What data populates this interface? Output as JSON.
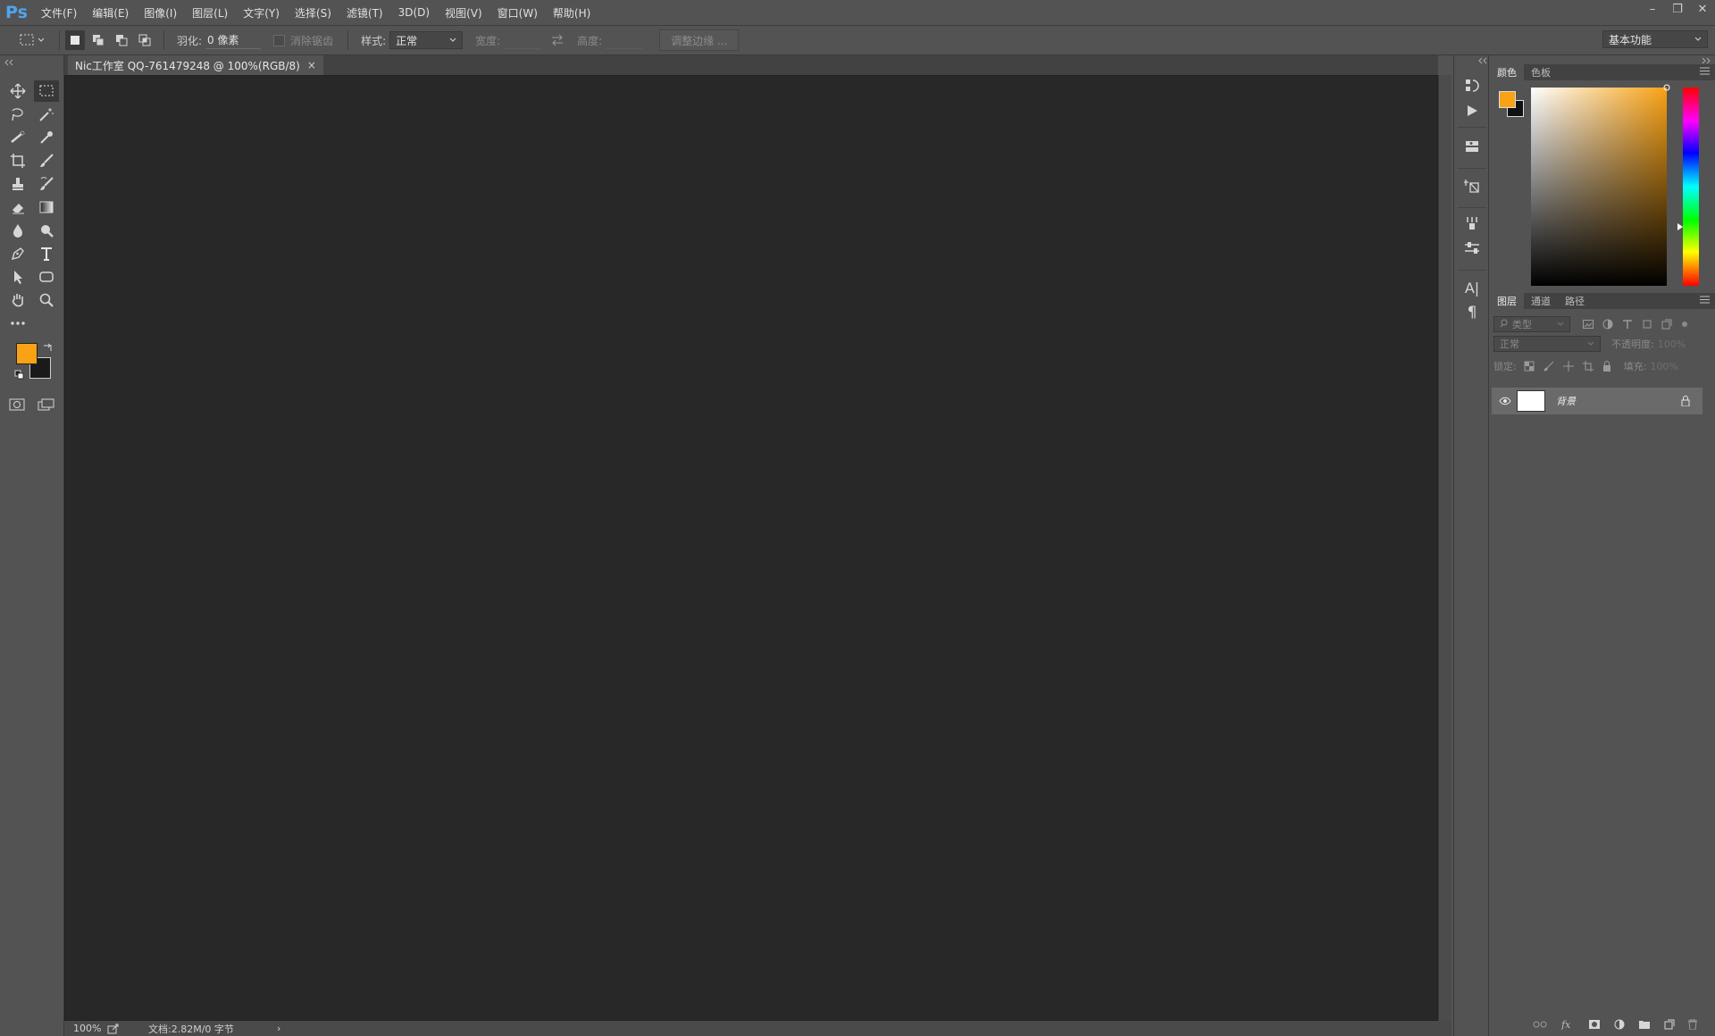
{
  "app": {
    "logo": "Ps"
  },
  "menu": [
    "文件(F)",
    "编辑(E)",
    "图像(I)",
    "图层(L)",
    "文字(Y)",
    "选择(S)",
    "滤镜(T)",
    "3D(D)",
    "视图(V)",
    "窗口(W)",
    "帮助(H)"
  ],
  "window": {
    "minimize": "–",
    "restore": "❐",
    "close": "✕"
  },
  "options": {
    "feather_label": "羽化:",
    "feather_value": "0 像素",
    "antialias_label": "消除锯齿",
    "style_label": "样式:",
    "style_value": "正常",
    "width_label": "宽度:",
    "height_label": "高度:",
    "refine_edge": "调整边缘 ...",
    "workspace": "基本功能"
  },
  "document": {
    "tab_title": "Nic工作室 QQ-761479248 @ 100%(RGB/8)",
    "close": "×"
  },
  "status": {
    "zoom": "100%",
    "doc_info": "文档:2.82M/0 字节",
    "arrow": "›"
  },
  "color_panel": {
    "tabs": [
      "颜色",
      "色板"
    ],
    "fg_color": "#f9a215",
    "bg_color": "#111111"
  },
  "layers_panel": {
    "tabs": [
      "图层",
      "通道",
      "路径"
    ],
    "filter_kind": "类型",
    "blend_mode": "正常",
    "opacity_label": "不透明度:",
    "opacity_value": "100%",
    "lock_label": "锁定:",
    "fill_label": "填充:",
    "fill_value": "100%",
    "layers": [
      {
        "name": "背景",
        "locked": true,
        "visible": true
      }
    ]
  },
  "strip_labels": {
    "char": "A|",
    "para": "¶"
  }
}
